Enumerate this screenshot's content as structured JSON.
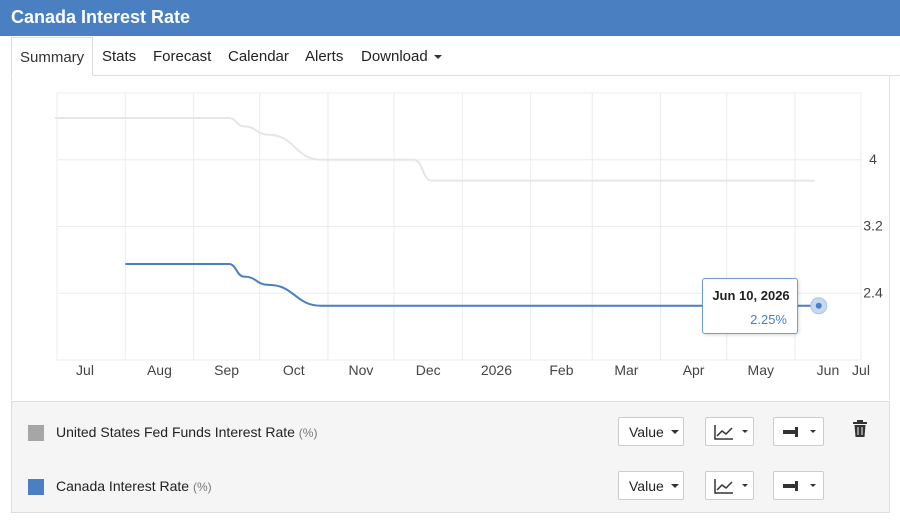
{
  "header": {
    "title": "Canada Interest Rate"
  },
  "tabs": [
    {
      "label": "Summary"
    },
    {
      "label": "Stats"
    },
    {
      "label": "Forecast"
    },
    {
      "label": "Calendar"
    },
    {
      "label": "Alerts"
    },
    {
      "label": "Download"
    }
  ],
  "tooltip": {
    "date": "Jun 10, 2026",
    "value": "2.25%"
  },
  "legend": {
    "series": [
      {
        "label": "United States Fed Funds Interest Rate",
        "unit": "(%)",
        "color": "#a6a6a6",
        "value_button": "Value",
        "chart_icon": "line-chart-icon",
        "line_icon": "line-style-icon",
        "delete_icon": "trash-icon"
      },
      {
        "label": "Canada Interest Rate",
        "unit": "(%)",
        "color": "#4a7fc1",
        "value_button": "Value",
        "chart_icon": "line-chart-icon",
        "line_icon": "line-style-icon"
      }
    ]
  },
  "colors": {
    "accent": "#4a7fc1",
    "us_series": "#e6e6e6",
    "ca_series": "#4a7fc1"
  },
  "chart_data": {
    "type": "line",
    "x_tick_labels": [
      "Jul",
      "Aug",
      "Sep",
      "Oct",
      "Nov",
      "Dec",
      "2026",
      "Feb",
      "Mar",
      "Apr",
      "May",
      "Jun",
      "Jul"
    ],
    "y_tick_labels": [
      "2.4",
      "3.2",
      "4"
    ],
    "yticks": [
      2.4,
      3.2,
      4.0
    ],
    "xlim": [
      "2025-07-01",
      "2026-07-01"
    ],
    "ylim": [
      1.6,
      4.8
    ],
    "grid": true,
    "y_axis_side": "right",
    "series": [
      {
        "name": "United States Fed Funds Interest Rate",
        "color": "#e6e6e6",
        "points": [
          {
            "x": "2025-06-30",
            "y": 4.5
          },
          {
            "x": "2025-09-17",
            "y": 4.5
          },
          {
            "x": "2025-09-24",
            "y": 4.4
          },
          {
            "x": "2025-10-05",
            "y": 4.3
          },
          {
            "x": "2025-10-29",
            "y": 4.0
          },
          {
            "x": "2025-12-10",
            "y": 4.0
          },
          {
            "x": "2025-12-18",
            "y": 3.75
          },
          {
            "x": "2026-06-10",
            "y": 3.75
          }
        ]
      },
      {
        "name": "Canada Interest Rate",
        "color": "#4a7fc1",
        "points": [
          {
            "x": "2025-08-01",
            "y": 2.75
          },
          {
            "x": "2025-09-17",
            "y": 2.75
          },
          {
            "x": "2025-09-24",
            "y": 2.6
          },
          {
            "x": "2025-10-05",
            "y": 2.5
          },
          {
            "x": "2025-10-29",
            "y": 2.25
          },
          {
            "x": "2026-06-10",
            "y": 2.25
          }
        ]
      }
    ],
    "highlight": {
      "x": "2026-06-10",
      "y": 2.25
    }
  }
}
